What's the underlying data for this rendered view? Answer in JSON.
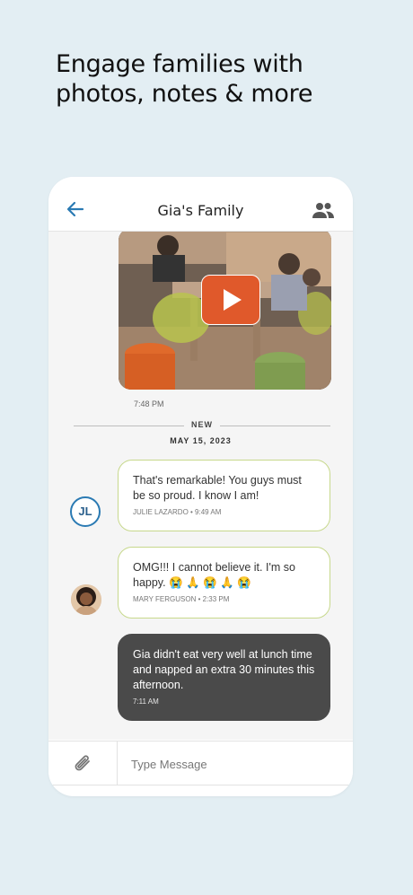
{
  "headline": {
    "line1": "Engage families with",
    "line2": "photos, notes & more"
  },
  "header": {
    "title": "Gia's Family",
    "back_icon": "arrow-left-icon",
    "members_icon": "people-icon",
    "accent": "#2a7ab3"
  },
  "video_message": {
    "time": "7:48 PM",
    "play_color": "#e0592b"
  },
  "divider": {
    "label": "NEW"
  },
  "date_header": "MAY 15, 2023",
  "messages": [
    {
      "text": "That's remarkable! You guys must be so proud. I know I am!",
      "meta": "JULIE LAZARDO • 9:49 AM",
      "avatar_initials": "JL",
      "direction": "incoming"
    },
    {
      "text": "OMG!!! I cannot believe it. I'm so happy. 😭 🙏 😭 🙏 😭",
      "meta": "MARY FERGUSON • 2:33 PM",
      "avatar": "photo",
      "direction": "incoming"
    },
    {
      "text": "Gia didn't eat very well at lunch time and napped an extra 30 minutes this afternoon.",
      "meta": "7:11 AM",
      "direction": "outgoing"
    }
  ],
  "composer": {
    "placeholder": "Type Message",
    "attach_icon": "paperclip-icon"
  }
}
